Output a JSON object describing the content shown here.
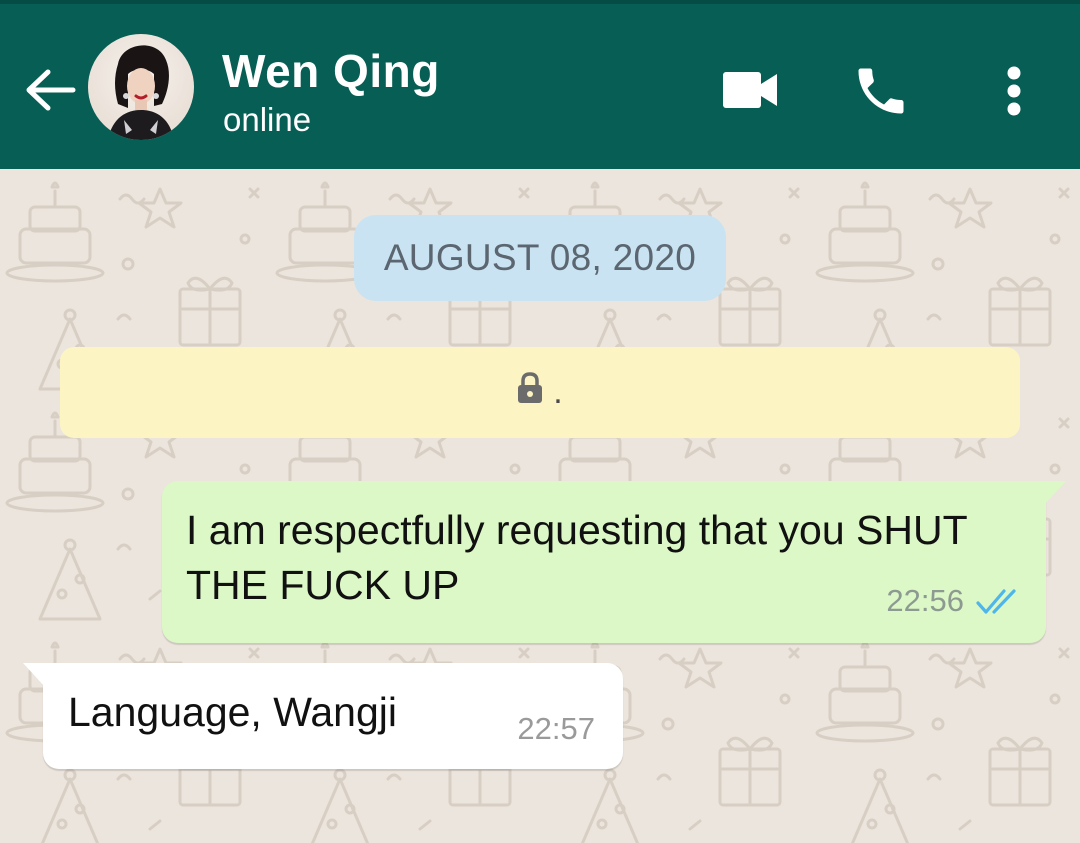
{
  "header": {
    "contact_name": "Wen Qing",
    "status": "online",
    "background_color": "#075e54",
    "icons": {
      "back": "arrow-left-icon",
      "video": "video-camera-icon",
      "call": "phone-icon",
      "menu": "more-vertical-icon"
    }
  },
  "chat": {
    "date_label": "AUGUST 08, 2020",
    "encryption_notice": {
      "icon": "lock-icon",
      "text": "."
    },
    "messages": [
      {
        "direction": "outgoing",
        "text": "I am respectfully requesting that you SHUT THE FUCK UP",
        "time": "22:56",
        "status": "read",
        "status_icon": "double-check-icon",
        "bubble_color": "#dcf8c6"
      },
      {
        "direction": "incoming",
        "text": "Language, Wangji",
        "time": "22:57",
        "bubble_color": "#ffffff"
      }
    ]
  },
  "colors": {
    "wallpaper": "#ece5dd",
    "date_chip": "#c9e3f2",
    "notice": "#fdf4c4",
    "read_ticks": "#4fb6ec"
  }
}
